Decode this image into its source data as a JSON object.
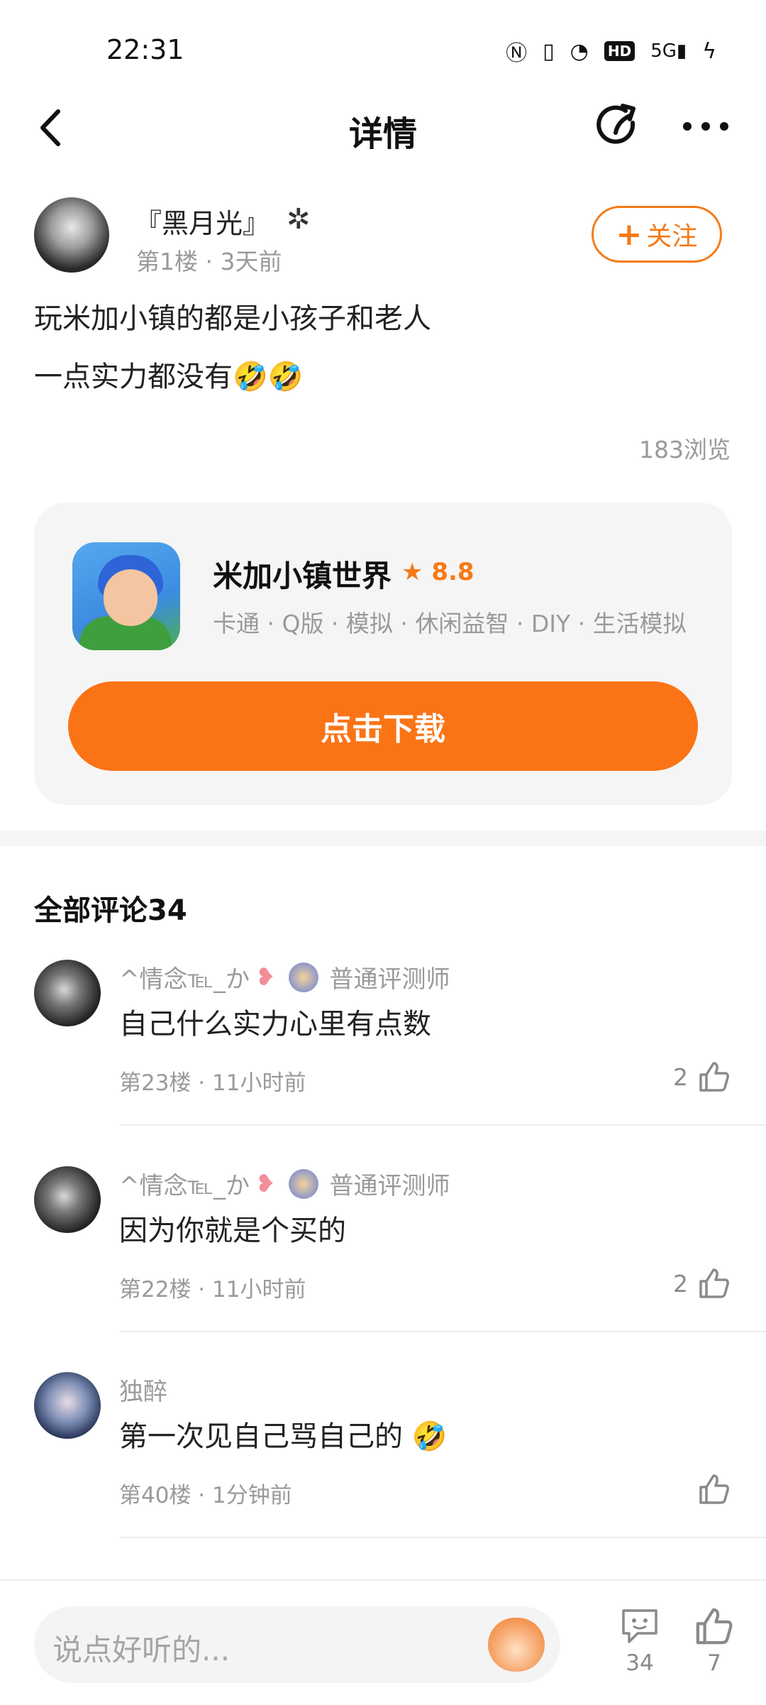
{
  "status_bar": {
    "time": "22:31",
    "hd": "HD",
    "network": "5G"
  },
  "nav": {
    "title": "详情"
  },
  "post": {
    "author": "『黑月光』",
    "floor": "第1楼",
    "time_ago": "3天前",
    "follow_label": "关注",
    "lines": [
      "玩米加小镇的都是小孩子和老人",
      "一点实力都没有🤣🤣"
    ],
    "views": "183浏览"
  },
  "game": {
    "name": "米加小镇世界",
    "rating": "8.8",
    "tags": "卡通 · Q版 · 模拟 · 休闲益智 · DIY · 生活模拟",
    "download_label": "点击下载"
  },
  "comments": {
    "title": "全部评论34",
    "items": [
      {
        "user": "^情念℡_か",
        "badge": "普通评测师",
        "text": "自己什么实力心里有点数",
        "floor": "第23楼",
        "time": "11小时前",
        "likes": "2"
      },
      {
        "user": "^情念℡_か",
        "badge": "普通评测师",
        "text": "因为你就是个买的",
        "floor": "第22楼",
        "time": "11小时前",
        "likes": "2"
      },
      {
        "user": "独醉",
        "badge": "",
        "text": "第一次见自己骂自己的 🤣",
        "floor": "第40楼",
        "time": "1分钟前",
        "likes": ""
      }
    ]
  },
  "bottom": {
    "placeholder": "说点好听的...",
    "comment_count": "34",
    "like_count": "7"
  }
}
